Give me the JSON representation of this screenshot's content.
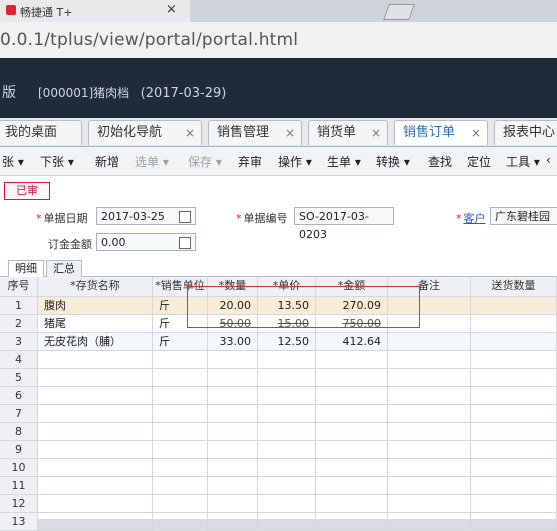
{
  "browser": {
    "tab_title": "畅捷通 T+",
    "tab_close": "×",
    "url": "0.0.1/tplus/view/portal/portal.html"
  },
  "header": {
    "edition": "版",
    "company": "[000001]猪肉档",
    "date": "(2017-03-29)"
  },
  "nav_tabs": [
    {
      "label": "我的桌面",
      "closable": false,
      "active": false
    },
    {
      "label": "初始化导航",
      "closable": true,
      "active": false
    },
    {
      "label": "销售管理",
      "closable": true,
      "active": false
    },
    {
      "label": "销货单",
      "closable": true,
      "active": false
    },
    {
      "label": "销售订单",
      "closable": true,
      "active": true
    },
    {
      "label": "报表中心",
      "closable": false,
      "active": false
    }
  ],
  "nav_close": "×",
  "toolbar": [
    {
      "label": "张 ▾",
      "enabled": true
    },
    {
      "label": "下张 ▾",
      "enabled": true
    },
    {
      "label": "新增",
      "enabled": true
    },
    {
      "label": "选单 ▾",
      "enabled": false
    },
    {
      "label": "保存 ▾",
      "enabled": false
    },
    {
      "label": "弃审",
      "enabled": true
    },
    {
      "label": "操作 ▾",
      "enabled": true
    },
    {
      "label": "生单 ▾",
      "enabled": true
    },
    {
      "label": "转换 ▾",
      "enabled": true
    },
    {
      "label": "查找",
      "enabled": true
    },
    {
      "label": "定位",
      "enabled": true
    },
    {
      "label": "工具 ▾",
      "enabled": true
    },
    {
      "label": "‹",
      "enabled": true
    }
  ],
  "form": {
    "status": "已审",
    "doc_date_label": "单据日期",
    "doc_date": "2017-03-25",
    "doc_no_label": "单据编号",
    "doc_no": "SO-2017-03-0203",
    "customer_label": "客户",
    "customer": "广东碧桂园小",
    "deposit_label": "订金金额",
    "deposit": "0.00"
  },
  "sub_tabs": [
    "明细",
    "汇总"
  ],
  "grid": {
    "headers": [
      "序号",
      "*存货名称",
      "*销售单位",
      "*数量",
      "*单价",
      "*金额",
      "备注",
      "送货数量"
    ],
    "rows": [
      {
        "no": "1",
        "name": "腹肉",
        "unit": "斤",
        "qty": "20.00",
        "price": "13.50",
        "amount": "270.09"
      },
      {
        "no": "2",
        "name": "猪尾",
        "unit": "斤",
        "qty": "50.00",
        "price": "15.00",
        "amount": "750.00"
      },
      {
        "no": "3",
        "name": "无皮花肉（脯）",
        "unit": "斤",
        "qty": "33.00",
        "price": "12.50",
        "amount": "412.64"
      },
      {
        "no": "4"
      },
      {
        "no": "5"
      },
      {
        "no": "6"
      },
      {
        "no": "7"
      },
      {
        "no": "8"
      },
      {
        "no": "9"
      },
      {
        "no": "10"
      },
      {
        "no": "11"
      },
      {
        "no": "12"
      },
      {
        "no": "13"
      }
    ]
  },
  "colors": {
    "header_bg": "#1f2b3a",
    "active_tab": "#2a6fb5",
    "status_red": "#d14",
    "highlight": "#e03232"
  }
}
